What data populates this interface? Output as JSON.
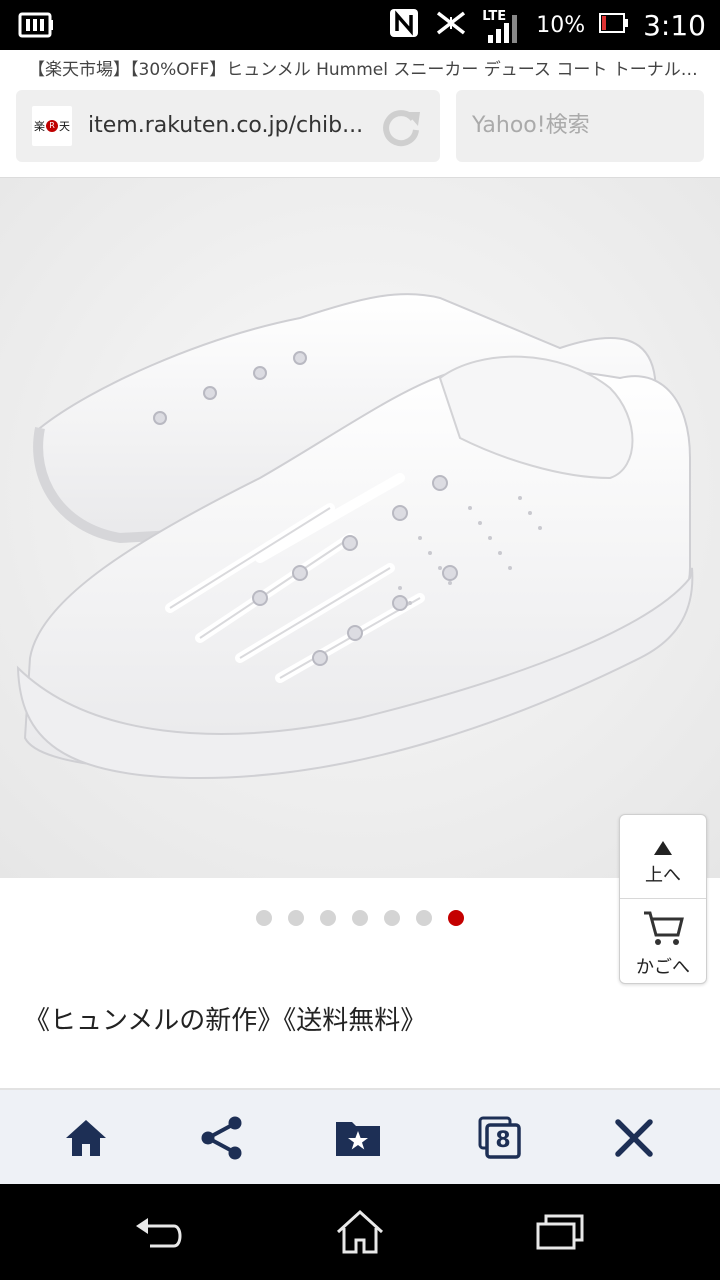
{
  "status_bar": {
    "battery_percent": "10%",
    "time": "3:10",
    "network_label": "LTE",
    "icons": [
      "battery-save-icon",
      "nfc-icon",
      "no-wifi-icon",
      "lte-signal-icon",
      "battery-icon"
    ]
  },
  "browser": {
    "page_title": "【楽天市場】【30%OFF】ヒュンメル Hummel スニーカー デュース コート トーナル 全...",
    "favicon_text": "楽",
    "favicon_mark": "R",
    "favicon_text2": "天",
    "url": "item.rakuten.co.jp/chib...",
    "search_placeholder": "Yahoo!検索"
  },
  "product": {
    "image_subject": "white-sneakers-image",
    "carousel": {
      "total": 7,
      "active_index": 6
    },
    "description": "《ヒュンメルの新作》《送料無料》"
  },
  "floating_buttons": {
    "to_top_label": "上へ",
    "cart_label": "かごへ"
  },
  "toolbar": {
    "tab_count": "8",
    "items": [
      "home-icon",
      "share-icon",
      "bookmark-folder-icon",
      "tabs-icon",
      "close-icon"
    ]
  },
  "colors": {
    "accent_red": "#c40000",
    "toolbar_icon": "#1d2f55",
    "toolbar_bg": "#eef1f6"
  }
}
